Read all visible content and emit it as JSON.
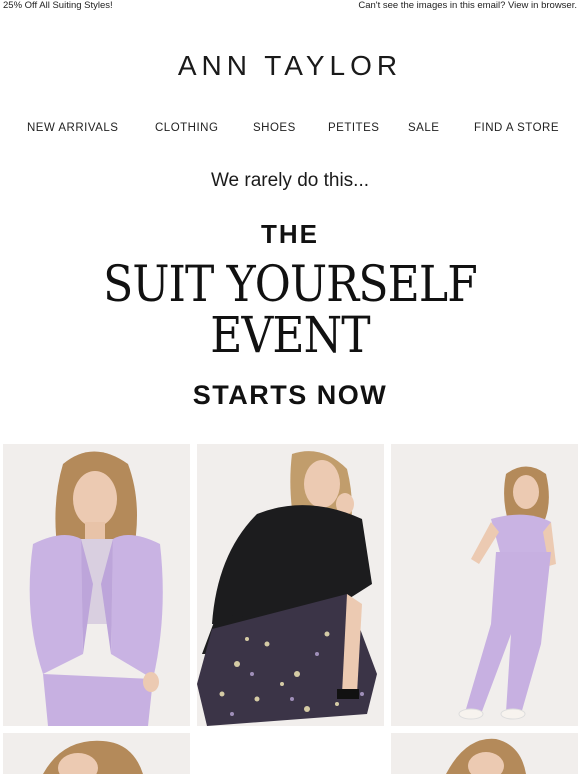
{
  "preheader": {
    "left": "25% Off All Suiting Styles!",
    "right": "Can't see the images in this email? View in browser."
  },
  "brand": {
    "logo": "ANN TAYLOR"
  },
  "nav": {
    "items": [
      "NEW ARRIVALS",
      "CLOTHING",
      "SHOES",
      "PETITES",
      "SALE",
      "FIND A STORE"
    ]
  },
  "hero": {
    "tagline": "We rarely do this...",
    "the": "THE",
    "headline_line1": "SUIT YOURSELF",
    "headline_line2": "EVENT",
    "starts": "STARTS NOW"
  },
  "colors": {
    "lavender": "#c9b3e3",
    "photo_bg": "#f1eeec",
    "text": "#111111"
  }
}
